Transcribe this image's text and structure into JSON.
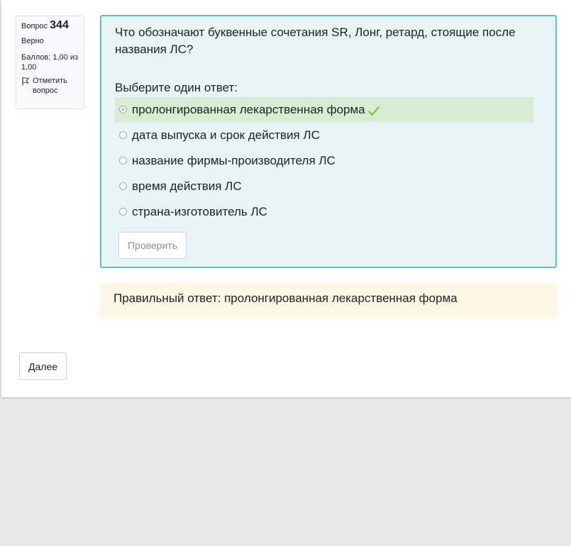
{
  "info": {
    "question_label": "Вопрос",
    "question_number": "344",
    "state": "Верно",
    "grade": "Баллов: 1,00 из 1,00",
    "flag_label": "Отметить вопрос",
    "flag_icon": "flag-icon"
  },
  "question": {
    "text": "Что обозначают буквенные сочетания SR, Лонг, ретард, стоящие после названия ЛС?",
    "prompt": "Выберите один ответ:",
    "answers": [
      {
        "label": "пролонгированная лекарственная форма",
        "selected": true,
        "correct": true
      },
      {
        "label": "дата выпуска и срок действия ЛС",
        "selected": false,
        "correct": false
      },
      {
        "label": "название фирмы-производителя ЛС",
        "selected": false,
        "correct": false
      },
      {
        "label": "время действия ЛС",
        "selected": false,
        "correct": false
      },
      {
        "label": "страна-изготовитель ЛС",
        "selected": false,
        "correct": false
      }
    ],
    "check_button": "Проверить",
    "correct_icon": "checkmark-icon"
  },
  "feedback": {
    "text": "Правильный ответ: пролонгированная лекарственная форма"
  },
  "navigation": {
    "next_button": "Далее"
  },
  "colors": {
    "question_bg": "#e7f3f5",
    "question_border": "#5bc0c7",
    "correct_answer_bg": "#d7ecd2",
    "feedback_bg": "#fcf8e3",
    "check_color": "#7fc93f"
  }
}
